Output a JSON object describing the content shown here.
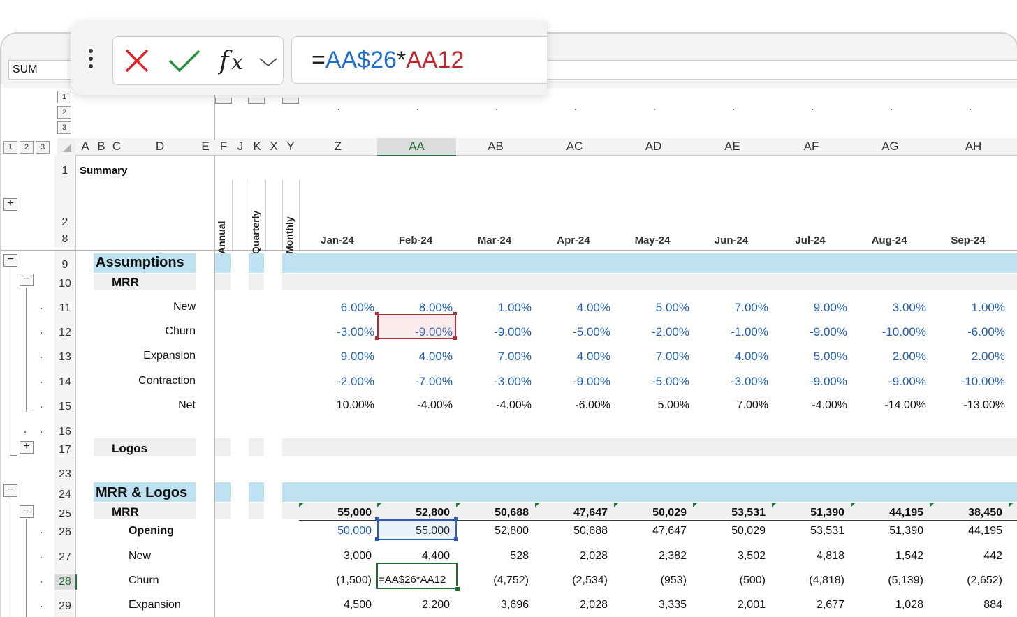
{
  "name_box": "SUM",
  "formula": {
    "prefix": "=",
    "ref1": "AA$26",
    "op": "*",
    "ref2": "AA12",
    "ref1_color": "#1f6fd0",
    "ref2_color": "#c0282d"
  },
  "outline_levels_rows": [
    "1",
    "2",
    "3"
  ],
  "outline_levels_cols": [
    "1",
    "2",
    "3"
  ],
  "columns": [
    "A",
    "B",
    "C",
    "D",
    "E",
    "F",
    "J",
    "K",
    "X",
    "Y",
    "Z",
    "AA",
    "AB",
    "AC",
    "AD",
    "AE",
    "AF",
    "AG",
    "AH"
  ],
  "rows": [
    "1",
    "2",
    "8",
    "9",
    "10",
    "11",
    "12",
    "13",
    "14",
    "15",
    "16",
    "17",
    "23",
    "24",
    "25",
    "26",
    "27",
    "28",
    "29"
  ],
  "summary_label": "Summary",
  "period_labels": [
    "Annual",
    "Quarterly",
    "Monthly"
  ],
  "months": [
    "Jan-24",
    "Feb-24",
    "Mar-24",
    "Apr-24",
    "May-24",
    "Jun-24",
    "Jul-24",
    "Aug-24",
    "Sep-24"
  ],
  "sections": {
    "assumptions": "Assumptions",
    "mrr": "MRR",
    "logos": "Logos",
    "mrr_logos": "MRR & Logos",
    "mrr2": "MRR"
  },
  "assumption_rows": [
    {
      "label": "New",
      "values": [
        "6.00%",
        "8.00%",
        "1.00%",
        "4.00%",
        "5.00%",
        "7.00%",
        "9.00%",
        "3.00%",
        "1.00%"
      ]
    },
    {
      "label": "Churn",
      "values": [
        "-3.00%",
        "-9.00%",
        "-9.00%",
        "-5.00%",
        "-2.00%",
        "-1.00%",
        "-9.00%",
        "-10.00%",
        "-6.00%"
      ]
    },
    {
      "label": "Expansion",
      "values": [
        "9.00%",
        "4.00%",
        "7.00%",
        "4.00%",
        "7.00%",
        "4.00%",
        "5.00%",
        "2.00%",
        "2.00%"
      ]
    },
    {
      "label": "Contraction",
      "values": [
        "-2.00%",
        "-7.00%",
        "-3.00%",
        "-9.00%",
        "-5.00%",
        "-3.00%",
        "-9.00%",
        "-9.00%",
        "-10.00%"
      ]
    },
    {
      "label": "Net",
      "values": [
        "10.00%",
        "-4.00%",
        "-4.00%",
        "-6.00%",
        "5.00%",
        "7.00%",
        "-4.00%",
        "-14.00%",
        "-13.00%"
      ]
    }
  ],
  "mrr_total": [
    "55,000",
    "52,800",
    "50,688",
    "47,647",
    "50,029",
    "53,531",
    "51,390",
    "44,195",
    "38,450"
  ],
  "mrr_rows": [
    {
      "label": "Opening",
      "values": [
        "50,000",
        "55,000",
        "52,800",
        "50,688",
        "47,647",
        "50,029",
        "53,531",
        "51,390",
        "44,195"
      ]
    },
    {
      "label": "New",
      "values": [
        "3,000",
        "4,400",
        "528",
        "2,028",
        "2,382",
        "3,502",
        "4,818",
        "1,542",
        "442"
      ]
    },
    {
      "label": "Churn",
      "values": [
        "(1,500)",
        "=AA$26*AA12",
        "(4,752)",
        "(2,534)",
        "(953)",
        "(500)",
        "(4,818)",
        "(5,139)",
        "(2,652)"
      ]
    },
    {
      "label": "Expansion",
      "values": [
        "4,500",
        "2,200",
        "3,696",
        "2,028",
        "3,335",
        "2,001",
        "2,677",
        "1,028",
        "884"
      ]
    }
  ]
}
